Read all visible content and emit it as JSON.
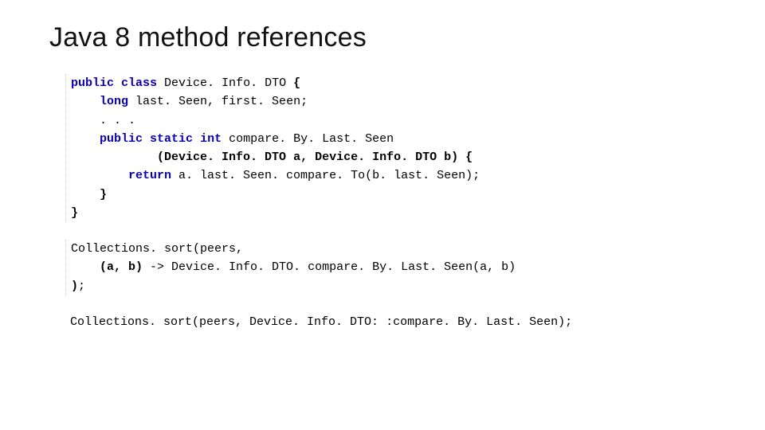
{
  "title": "Java 8 method references",
  "code": {
    "l1_public": "public",
    "l1_class": "class",
    "l1_name": " Device. Info. DTO ",
    "l1_brace": "{",
    "l2_long": "long",
    "l2_rest": " last. Seen, first. Seen;",
    "l3_dots": ". . .",
    "l4_public": "public",
    "l4_static": "static",
    "l4_int": "int",
    "l4_name": " compare. By. Last. Seen",
    "l5_params": "(Device. Info. DTO ",
    "l5_a": "a",
    "l5_mid": ", Device. Info. DTO ",
    "l5_b": "b",
    "l5_end": ") {",
    "l6_return": "return",
    "l6_rest": " a. last. Seen. compare. To(b. last. Seen);",
    "l7_close": "}",
    "l8_close": "}",
    "s2_l1_a": "Collections. sort(peers,",
    "s2_l2_a": "(a, b)",
    "s2_l2_b": " -> Device. Info. DTO. compare. By. Last. Seen(a, b)",
    "s2_l3_a": ")",
    "s2_l3_b": ";",
    "s3_l1_a": "Collections. sort(peers, Device. Info. DTO: :compare. By. Last. Seen);"
  }
}
